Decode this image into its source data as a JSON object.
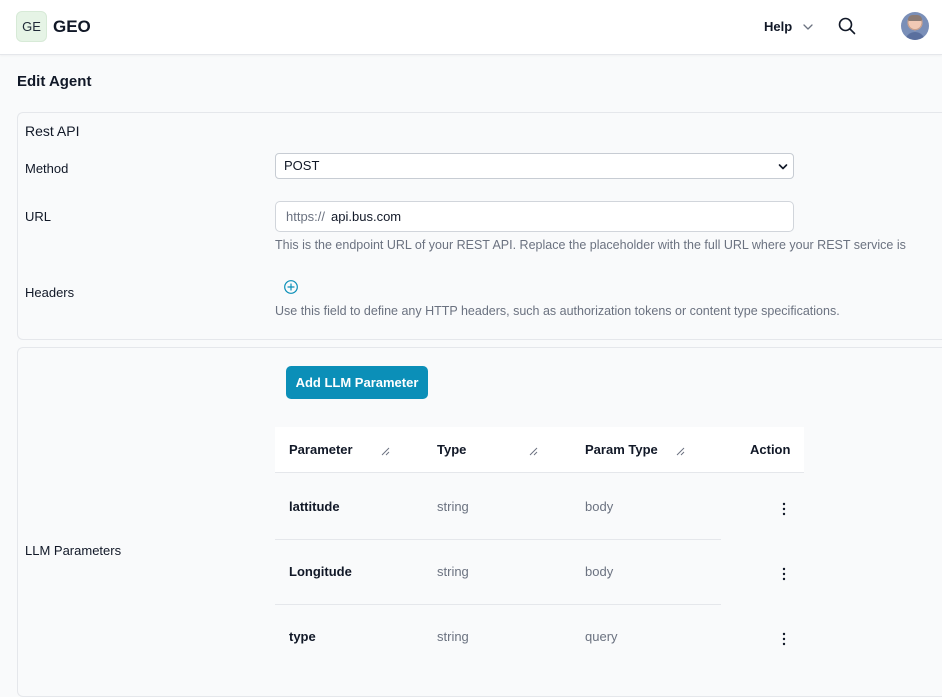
{
  "header": {
    "logo_initials": "GE",
    "brand": "GEO",
    "help_label": "Help",
    "icons": {
      "help_dropdown": "chevron-down-icon",
      "search": "search-icon",
      "avatar": "user-avatar"
    }
  },
  "page": {
    "title": "Edit Agent"
  },
  "rest_api": {
    "section_title": "Rest API",
    "method_label": "Method",
    "method_value": "POST",
    "url_label": "URL",
    "url_prefix": "https://",
    "url_value": "api.bus.com",
    "url_help": "This is the endpoint URL of your REST API. Replace the placeholder with the full URL where your REST service is",
    "headers_label": "Headers",
    "headers_help": "Use this field to define any HTTP headers, such as authorization tokens or content type specifications."
  },
  "llm": {
    "section_label": "LLM Parameters",
    "add_button": "Add LLM Parameter",
    "columns": [
      "Parameter",
      "Type",
      "Param Type",
      "Action"
    ],
    "rows": [
      {
        "name": "lattitude",
        "type": "string",
        "param_type": "body"
      },
      {
        "name": "Longitude",
        "type": "string",
        "param_type": "body"
      },
      {
        "name": "type",
        "type": "string",
        "param_type": "query"
      }
    ]
  },
  "colors": {
    "accent": "#0b8fb8",
    "logo_bg": "#e6f4e6",
    "muted_text": "#6b7280",
    "border": "#e5e7eb"
  }
}
